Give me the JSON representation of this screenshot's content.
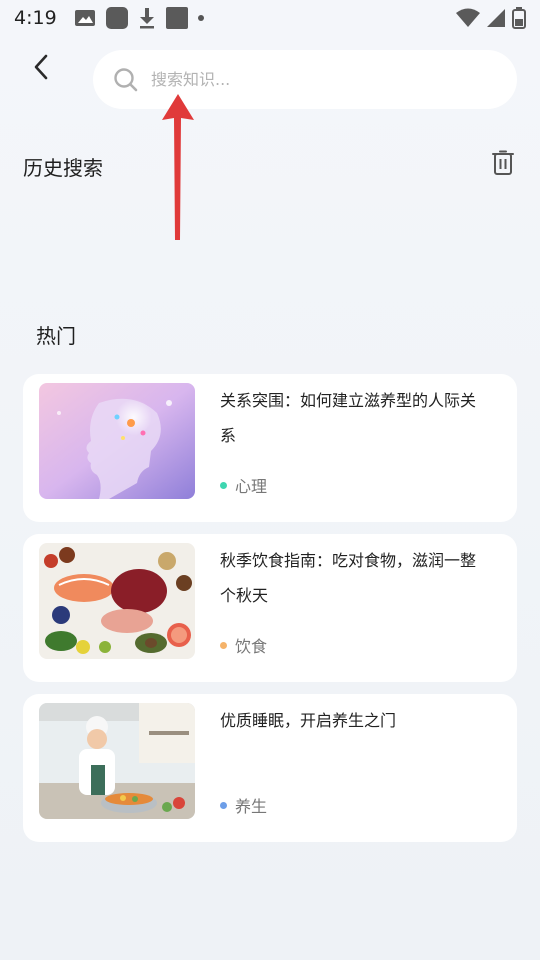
{
  "status_bar": {
    "time": "4:19"
  },
  "search": {
    "placeholder": "搜索知识..."
  },
  "history": {
    "title": "历史搜索"
  },
  "hot": {
    "title": "热门",
    "items": [
      {
        "title": "关系突围：如何建立滋养型的人际关系",
        "tag": "心理",
        "tag_color": "#3ed6b0",
        "image": "brain-illustration"
      },
      {
        "title": "秋季饮食指南：吃对食物，滋润一整个秋天",
        "tag": "饮食",
        "tag_color": "#f5b36a",
        "image": "food-spread-illustration"
      },
      {
        "title": "优质睡眠，开启养生之门",
        "tag": "养生",
        "tag_color": "#6d9ee8",
        "image": "chef-cooking-illustration"
      }
    ]
  },
  "colors": {
    "accent_arrow": "#e03a3a",
    "background": "#f1f4f8",
    "card": "#ffffff"
  }
}
